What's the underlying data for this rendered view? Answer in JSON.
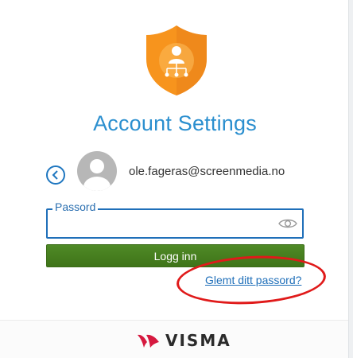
{
  "header": {
    "title": "Account Settings"
  },
  "account": {
    "email": "ole.fageras@screenmedia.no"
  },
  "password": {
    "label": "Passord",
    "value": ""
  },
  "actions": {
    "login_label": "Logg inn",
    "forgot_label": "Glemt ditt passord?"
  },
  "footer": {
    "brand": "VISMA"
  },
  "colors": {
    "accent": "#2b8fcf",
    "button": "#437a1c",
    "shield": "#f7941d",
    "annotation": "#e01a1a"
  }
}
